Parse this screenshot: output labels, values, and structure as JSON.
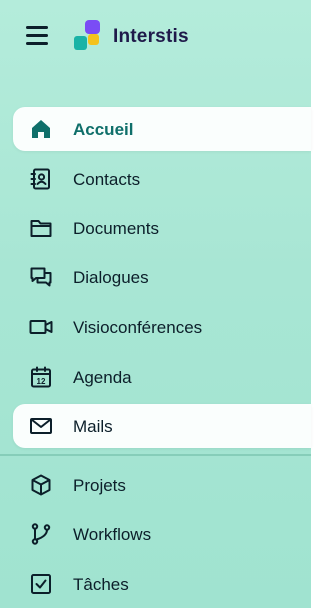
{
  "app": {
    "name": "Interstis"
  },
  "colors": {
    "accent": "#0f6f6a",
    "text": "#0c1f2a",
    "brand_text": "#1f1a4a",
    "logo_purple": "#7a4cf5",
    "logo_yellow": "#f4c21c",
    "logo_teal": "#19b3a6"
  },
  "nav": {
    "accueil": {
      "label": "Accueil",
      "icon": "home-icon",
      "active": true
    },
    "contacts": {
      "label": "Contacts",
      "icon": "contacts-book-icon"
    },
    "documents": {
      "label": "Documents",
      "icon": "folder-icon"
    },
    "dialogues": {
      "label": "Dialogues",
      "icon": "chat-bubbles-icon"
    },
    "visio": {
      "label": "Visioconférences",
      "icon": "video-camera-icon"
    },
    "agenda": {
      "label": "Agenda",
      "icon": "calendar-icon"
    },
    "mails": {
      "label": "Mails",
      "icon": "mail-envelope-icon",
      "highlighted": true
    },
    "projets": {
      "label": "Projets",
      "icon": "cube-icon"
    },
    "workflows": {
      "label": "Workflows",
      "icon": "git-branch-icon"
    },
    "taches": {
      "label": "Tâches",
      "icon": "checkbox-icon"
    }
  }
}
